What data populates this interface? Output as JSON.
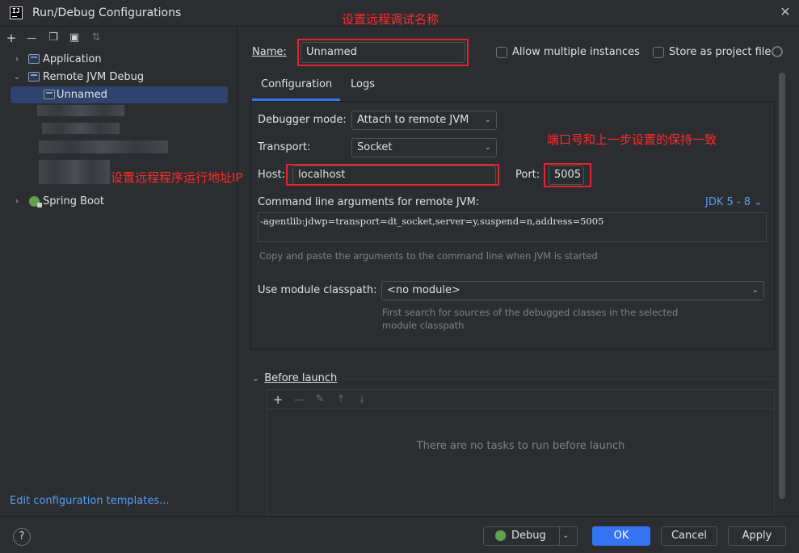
{
  "window": {
    "title": "Run/Debug Configurations",
    "logo_text": "IJ",
    "close_glyph": "✕"
  },
  "left_toolbar": {
    "add": "+",
    "remove": "—",
    "copy": "❐",
    "folder": "▣",
    "sort": "⇅"
  },
  "tree": {
    "expand_glyph": "›",
    "collapse_glyph": "⌄",
    "application": "Application",
    "remote_jvm_debug": "Remote JVM Debug",
    "unnamed": "Unnamed",
    "spring_boot": "Spring Boot"
  },
  "edit_templates": "Edit configuration templates...",
  "form": {
    "name_label": "Name:",
    "name_value": "Unnamed",
    "allow_multiple": "Allow multiple instances",
    "store_project": "Store as project file",
    "tab_configuration": "Configuration",
    "tab_logs": "Logs",
    "debugger_mode_label": "Debugger mode:",
    "debugger_mode_value": "Attach to remote JVM",
    "transport_label": "Transport:",
    "transport_value": "Socket",
    "host_label": "Host:",
    "host_value": "localhost",
    "port_label": "Port:",
    "port_value": "5005",
    "cmdline_label": "Command line arguments for remote JVM:",
    "jdk_link": "JDK 5 - 8 ⌄",
    "cmdline_value": "-agentlib:jdwp=transport=dt_socket,server=y,suspend=n,address=5005",
    "cmdline_hint": "Copy and paste the arguments to the command line when JVM is started",
    "module_label": "Use module classpath:",
    "module_value": "<no module>",
    "module_hint_1": "First search for sources of the debugged classes in the selected",
    "module_hint_2": "module classpath"
  },
  "before_launch": {
    "header": "Before launch",
    "chevron": "⌄",
    "add": "+",
    "remove": "—",
    "edit": "✎",
    "up": "⤒",
    "down": "⤓",
    "empty": "There are no tasks to run before launch"
  },
  "annotations": {
    "name": "设置远程调试名称",
    "port": "端口号和上一步设置的保持一致",
    "host": "设置远程程序运行地址IP"
  },
  "bottom": {
    "help": "?",
    "debug": "Debug",
    "debug_dropdown": "⌄",
    "ok": "OK",
    "cancel": "Cancel",
    "apply": "Apply"
  },
  "colors": {
    "accent": "#3574f0",
    "annotation": "#e0262e",
    "link": "#589df6"
  }
}
